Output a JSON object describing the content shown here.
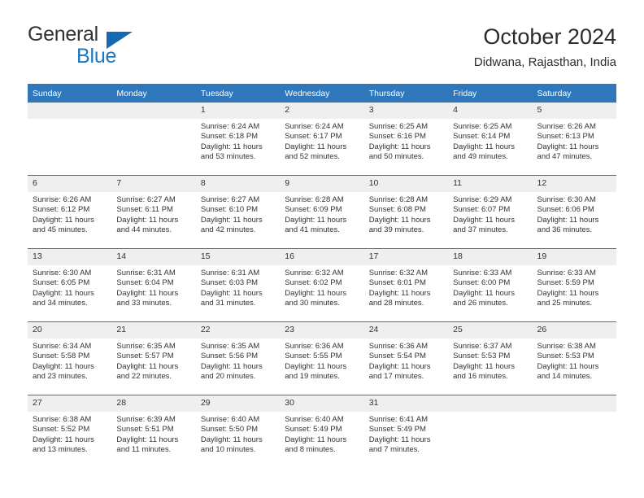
{
  "brand": {
    "name_top": "General",
    "name_bottom": "Blue",
    "accent_color": "#1b76c4",
    "flag_color": "#1668b3"
  },
  "header": {
    "title": "October 2024",
    "location": "Didwana, Rajasthan, India"
  },
  "theme": {
    "header_row_color": "#2e77bb",
    "daynum_strip_color": "#efefef",
    "text_color": "#333333"
  },
  "weekday_headers": [
    "Sunday",
    "Monday",
    "Tuesday",
    "Wednesday",
    "Thursday",
    "Friday",
    "Saturday"
  ],
  "weeks": [
    [
      {
        "day": "",
        "blank": true
      },
      {
        "day": "",
        "blank": true
      },
      {
        "day": "1",
        "sunrise": "Sunrise: 6:24 AM",
        "sunset": "Sunset: 6:18 PM",
        "daylight_line1": "Daylight: 11 hours",
        "daylight_line2": "and 53 minutes."
      },
      {
        "day": "2",
        "sunrise": "Sunrise: 6:24 AM",
        "sunset": "Sunset: 6:17 PM",
        "daylight_line1": "Daylight: 11 hours",
        "daylight_line2": "and 52 minutes."
      },
      {
        "day": "3",
        "sunrise": "Sunrise: 6:25 AM",
        "sunset": "Sunset: 6:16 PM",
        "daylight_line1": "Daylight: 11 hours",
        "daylight_line2": "and 50 minutes."
      },
      {
        "day": "4",
        "sunrise": "Sunrise: 6:25 AM",
        "sunset": "Sunset: 6:14 PM",
        "daylight_line1": "Daylight: 11 hours",
        "daylight_line2": "and 49 minutes."
      },
      {
        "day": "5",
        "sunrise": "Sunrise: 6:26 AM",
        "sunset": "Sunset: 6:13 PM",
        "daylight_line1": "Daylight: 11 hours",
        "daylight_line2": "and 47 minutes."
      }
    ],
    [
      {
        "day": "6",
        "sunrise": "Sunrise: 6:26 AM",
        "sunset": "Sunset: 6:12 PM",
        "daylight_line1": "Daylight: 11 hours",
        "daylight_line2": "and 45 minutes."
      },
      {
        "day": "7",
        "sunrise": "Sunrise: 6:27 AM",
        "sunset": "Sunset: 6:11 PM",
        "daylight_line1": "Daylight: 11 hours",
        "daylight_line2": "and 44 minutes."
      },
      {
        "day": "8",
        "sunrise": "Sunrise: 6:27 AM",
        "sunset": "Sunset: 6:10 PM",
        "daylight_line1": "Daylight: 11 hours",
        "daylight_line2": "and 42 minutes."
      },
      {
        "day": "9",
        "sunrise": "Sunrise: 6:28 AM",
        "sunset": "Sunset: 6:09 PM",
        "daylight_line1": "Daylight: 11 hours",
        "daylight_line2": "and 41 minutes."
      },
      {
        "day": "10",
        "sunrise": "Sunrise: 6:28 AM",
        "sunset": "Sunset: 6:08 PM",
        "daylight_line1": "Daylight: 11 hours",
        "daylight_line2": "and 39 minutes."
      },
      {
        "day": "11",
        "sunrise": "Sunrise: 6:29 AM",
        "sunset": "Sunset: 6:07 PM",
        "daylight_line1": "Daylight: 11 hours",
        "daylight_line2": "and 37 minutes."
      },
      {
        "day": "12",
        "sunrise": "Sunrise: 6:30 AM",
        "sunset": "Sunset: 6:06 PM",
        "daylight_line1": "Daylight: 11 hours",
        "daylight_line2": "and 36 minutes."
      }
    ],
    [
      {
        "day": "13",
        "sunrise": "Sunrise: 6:30 AM",
        "sunset": "Sunset: 6:05 PM",
        "daylight_line1": "Daylight: 11 hours",
        "daylight_line2": "and 34 minutes."
      },
      {
        "day": "14",
        "sunrise": "Sunrise: 6:31 AM",
        "sunset": "Sunset: 6:04 PM",
        "daylight_line1": "Daylight: 11 hours",
        "daylight_line2": "and 33 minutes."
      },
      {
        "day": "15",
        "sunrise": "Sunrise: 6:31 AM",
        "sunset": "Sunset: 6:03 PM",
        "daylight_line1": "Daylight: 11 hours",
        "daylight_line2": "and 31 minutes."
      },
      {
        "day": "16",
        "sunrise": "Sunrise: 6:32 AM",
        "sunset": "Sunset: 6:02 PM",
        "daylight_line1": "Daylight: 11 hours",
        "daylight_line2": "and 30 minutes."
      },
      {
        "day": "17",
        "sunrise": "Sunrise: 6:32 AM",
        "sunset": "Sunset: 6:01 PM",
        "daylight_line1": "Daylight: 11 hours",
        "daylight_line2": "and 28 minutes."
      },
      {
        "day": "18",
        "sunrise": "Sunrise: 6:33 AM",
        "sunset": "Sunset: 6:00 PM",
        "daylight_line1": "Daylight: 11 hours",
        "daylight_line2": "and 26 minutes."
      },
      {
        "day": "19",
        "sunrise": "Sunrise: 6:33 AM",
        "sunset": "Sunset: 5:59 PM",
        "daylight_line1": "Daylight: 11 hours",
        "daylight_line2": "and 25 minutes."
      }
    ],
    [
      {
        "day": "20",
        "sunrise": "Sunrise: 6:34 AM",
        "sunset": "Sunset: 5:58 PM",
        "daylight_line1": "Daylight: 11 hours",
        "daylight_line2": "and 23 minutes."
      },
      {
        "day": "21",
        "sunrise": "Sunrise: 6:35 AM",
        "sunset": "Sunset: 5:57 PM",
        "daylight_line1": "Daylight: 11 hours",
        "daylight_line2": "and 22 minutes."
      },
      {
        "day": "22",
        "sunrise": "Sunrise: 6:35 AM",
        "sunset": "Sunset: 5:56 PM",
        "daylight_line1": "Daylight: 11 hours",
        "daylight_line2": "and 20 minutes."
      },
      {
        "day": "23",
        "sunrise": "Sunrise: 6:36 AM",
        "sunset": "Sunset: 5:55 PM",
        "daylight_line1": "Daylight: 11 hours",
        "daylight_line2": "and 19 minutes."
      },
      {
        "day": "24",
        "sunrise": "Sunrise: 6:36 AM",
        "sunset": "Sunset: 5:54 PM",
        "daylight_line1": "Daylight: 11 hours",
        "daylight_line2": "and 17 minutes."
      },
      {
        "day": "25",
        "sunrise": "Sunrise: 6:37 AM",
        "sunset": "Sunset: 5:53 PM",
        "daylight_line1": "Daylight: 11 hours",
        "daylight_line2": "and 16 minutes."
      },
      {
        "day": "26",
        "sunrise": "Sunrise: 6:38 AM",
        "sunset": "Sunset: 5:53 PM",
        "daylight_line1": "Daylight: 11 hours",
        "daylight_line2": "and 14 minutes."
      }
    ],
    [
      {
        "day": "27",
        "sunrise": "Sunrise: 6:38 AM",
        "sunset": "Sunset: 5:52 PM",
        "daylight_line1": "Daylight: 11 hours",
        "daylight_line2": "and 13 minutes."
      },
      {
        "day": "28",
        "sunrise": "Sunrise: 6:39 AM",
        "sunset": "Sunset: 5:51 PM",
        "daylight_line1": "Daylight: 11 hours",
        "daylight_line2": "and 11 minutes."
      },
      {
        "day": "29",
        "sunrise": "Sunrise: 6:40 AM",
        "sunset": "Sunset: 5:50 PM",
        "daylight_line1": "Daylight: 11 hours",
        "daylight_line2": "and 10 minutes."
      },
      {
        "day": "30",
        "sunrise": "Sunrise: 6:40 AM",
        "sunset": "Sunset: 5:49 PM",
        "daylight_line1": "Daylight: 11 hours",
        "daylight_line2": "and 8 minutes."
      },
      {
        "day": "31",
        "sunrise": "Sunrise: 6:41 AM",
        "sunset": "Sunset: 5:49 PM",
        "daylight_line1": "Daylight: 11 hours",
        "daylight_line2": "and 7 minutes."
      },
      {
        "day": "",
        "blank": true
      },
      {
        "day": "",
        "blank": true
      }
    ]
  ]
}
